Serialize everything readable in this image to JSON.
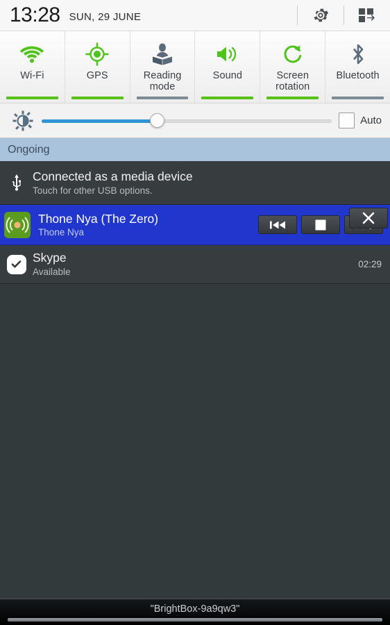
{
  "statusbar": {
    "time": "13:28",
    "date": "SUN, 29 JUNE",
    "settings_icon": "gear-icon",
    "quick_settings_icon": "grid-swap-icon"
  },
  "quick_toggles": [
    {
      "label": "Wi-Fi",
      "icon": "wifi-icon",
      "state": "on",
      "accent": "#57c118"
    },
    {
      "label": "GPS",
      "icon": "gps-target-icon",
      "state": "on",
      "accent": "#57c118"
    },
    {
      "label": "Reading\nmode",
      "icon": "reading-mode-icon",
      "state": "off",
      "accent": "#7b8a95"
    },
    {
      "label": "Sound",
      "icon": "speaker-icon",
      "state": "on",
      "accent": "#57c118"
    },
    {
      "label": "Screen\nrotation",
      "icon": "rotate-icon",
      "state": "on",
      "accent": "#57c118"
    },
    {
      "label": "Bluetooth",
      "icon": "bluetooth-icon",
      "state": "off",
      "accent": "#7b8a95"
    }
  ],
  "toggle_labels": {
    "wifi": "Wi-Fi",
    "gps": "GPS",
    "reading_line1": "Reading",
    "reading_line2": "mode",
    "sound": "Sound",
    "rotation_line1": "Screen",
    "rotation_line2": "rotation",
    "bluetooth": "Bluetooth"
  },
  "brightness": {
    "icon": "brightness-icon",
    "value_percent": 40,
    "auto_label": "Auto",
    "auto_checked": false,
    "fill_color": "#2f93d4"
  },
  "sections": {
    "ongoing_label": "Ongoing",
    "ongoing_bg": "#a9c3dd"
  },
  "notifications": [
    {
      "id": "usb",
      "icon": "usb-icon",
      "title": "Connected as a media device",
      "subtitle": "Touch for other USB options.",
      "bg": "#373d3f"
    },
    {
      "id": "music",
      "icon": "album-art-icon",
      "title": "Thone Nya (The Zero)",
      "subtitle": "Thone Nya",
      "bg": "#2036cc",
      "controls": {
        "previous": "previous-track-icon",
        "stop": "stop-icon",
        "next": "next-track-icon",
        "close": "close-icon"
      }
    },
    {
      "id": "skype",
      "icon": "skype-check-icon",
      "title": "Skype",
      "subtitle": "Available",
      "time": "02:29",
      "bg": "#373d3f"
    }
  ],
  "bottom": {
    "ssid": "\"BrightBox-9a9qw3\"",
    "handle": "drag-handle"
  }
}
